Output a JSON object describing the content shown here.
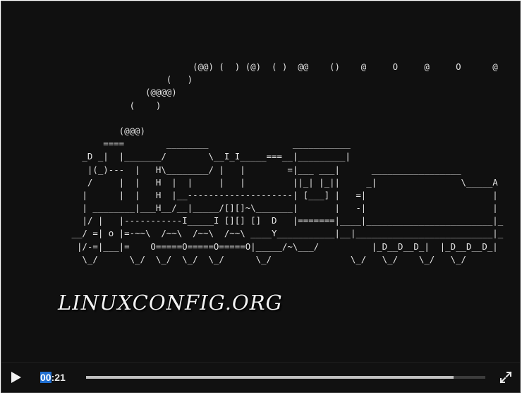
{
  "player": {
    "ascii_art_lines": [
      "                                   (@@) (  ) (@)  ( )  @@    ()    @     O     @     O      @",
      "                              (   )",
      "                          (@@@@)",
      "                       (    )",
      "",
      "                     (@@@)",
      "                  ====        ________                ___________",
      "              _D _|  |_______/        \\__I_I_____===__|_________|",
      "               |(_)---  |   H\\________/ |   |        =|___ ___|      _________________",
      "               /     |  |   H  |  |     |   |         ||_| |_||     _|                \\_____A",
      "              |      |  |   H  |__--------------------| [___] |   =|                        |",
      "              | ________|___H__/__|_____/[][]~\\_______|       |   -|                        |",
      "              |/ |   |-----------I_____I [][] []  D   |=======|____|________________________|_",
      "            __/ =| o |=-~~\\  /~~\\  /~~\\  /~~\\ ____Y___________|__|__________________________|_",
      "             |/-=|___|=    O=====O=====O=====O|_____/~\\___/          |_D__D__D_|  |_D__D__D_|",
      "              \\_/      \\_/  \\_/  \\_/  \\_/      \\_/               \\_/   \\_/    \\_/   \\_/"
    ],
    "watermark": "LINUXCONFIG.ORG",
    "controls": {
      "time_highlight": "00",
      "time_rest": ":21",
      "progress_fraction": 0.92,
      "play_icon": "play-icon",
      "fullscreen_icon": "fullscreen-icon"
    }
  }
}
